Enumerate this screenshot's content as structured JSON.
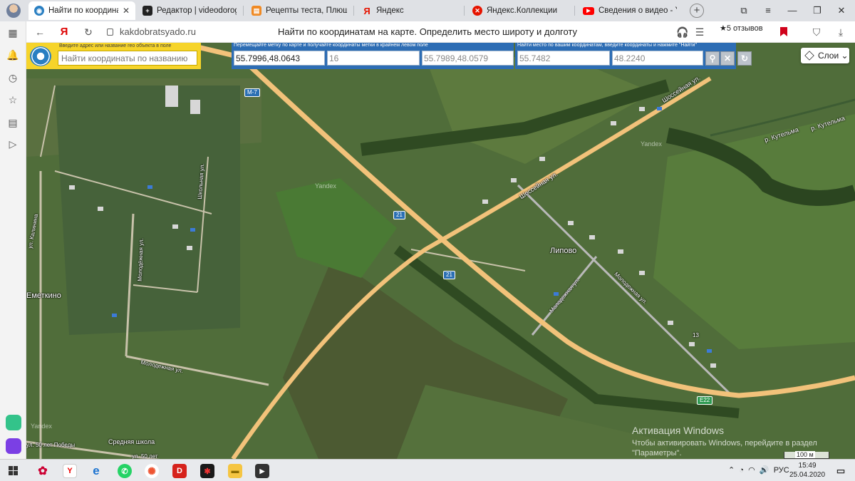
{
  "browser": {
    "tabs": [
      {
        "title": "Найти по координатам",
        "favicon_color": "#2a7fc2",
        "active": true
      },
      {
        "title": "Редактор | videodorogros",
        "favicon_color": "#222222",
        "active": false
      },
      {
        "title": "Рецепты теста, Плюшка к",
        "favicon_color": "#f08a24",
        "active": false
      },
      {
        "title": "Яндекс",
        "favicon_color": "#e61400",
        "active": false
      },
      {
        "title": "Яндекс.Коллекции",
        "favicon_color": "#e61400",
        "active": false
      },
      {
        "title": "Сведения о видео - YouT",
        "favicon_color": "#ff0000",
        "active": false
      }
    ],
    "tab_close": "✕",
    "new_tab": "+",
    "url": "kakdobratsyado.ru",
    "page_title": "Найти по координатам на карте. Определить место широту и долготу",
    "reviews": "★5 отзывов",
    "yandex_logo": "Я"
  },
  "panel": {
    "search_hint": "Введите адрес или название гео объекта в поле",
    "search_placeholder": "Найти координаты по названию",
    "drag_hint": "Перемещайте метку по карте и получайте координаты метки в крайнем левом поле",
    "marker_coords": "55.7996,48.0643",
    "zoom": "16",
    "center_coords": "55.7989,48.0579",
    "find_hint": "Найти место по вашим координатам, введите координаты и нажмите \"Найти\"",
    "lat_input": "55.7482",
    "lon_input": "48.2240",
    "layers_label": "Слои"
  },
  "map": {
    "labels": {
      "village": "Липово",
      "village2": "Еметкино",
      "school": "Средняя школа",
      "street_shosseynaya1": "Шоссейная ул.",
      "street_shosseynaya2": "Шоссейная ул.",
      "street_molodezhnaya1": "Молодежная ул.",
      "street_molodezhnaya2": "Молодежная ул.",
      "street_molodezhnaya3": "Молодёжная ул.",
      "street_molodezhnaya4": "Молодежная ул.",
      "street_shkolnaya": "Школьная ул.",
      "street_kalinina": "ул. Калинина",
      "street_50let": "ул. 50 лет Победы",
      "street_50let2": "ул. 50 лет",
      "river1": "р. Кутельма",
      "river2": "р. Кутельма",
      "house_number": "13",
      "yandex1": "Yandex",
      "yandex2": "Yandex",
      "yandex3": "Yandex"
    },
    "road_badges": {
      "m7": "М-7",
      "r21a": "21",
      "r21b": "21",
      "e22": "E22"
    },
    "scale": "100 м"
  },
  "activation": {
    "title": "Активация Windows",
    "line1": "Чтобы активировать Windows, перейдите в раздел",
    "line2": "\"Параметры\"."
  },
  "taskbar": {
    "lang": "РУС",
    "time": "15:49",
    "date": "25.04.2020"
  }
}
